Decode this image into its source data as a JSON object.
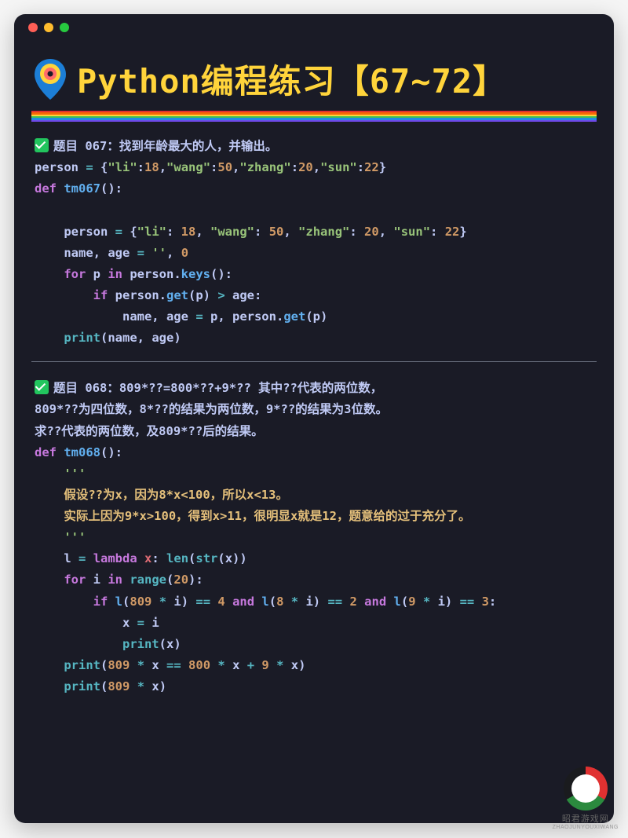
{
  "header": {
    "title": "Python编程练习【67~72】"
  },
  "block067": {
    "topic_prefix": "题目 067：",
    "topic_text": "找到年龄最大的人，并输出。",
    "line_data": "person = {\"li\":18,\"wang\":50,\"zhang\":20,\"sun\":22}",
    "def": "def tm067():",
    "l1": "    person = {\"li\": 18, \"wang\": 50, \"zhang\": 20, \"sun\": 22}",
    "l2": "    name, age = '', 0",
    "l3": "    for p in person.keys():",
    "l4": "        if person.get(p) > age:",
    "l5": "            name, age = p, person.get(p)",
    "l6": "    print(name, age)"
  },
  "block068": {
    "topic_prefix": "题目 068：",
    "topic_line1": "809*??=800*??+9*?? 其中??代表的两位数，",
    "topic_line2": "809*??为四位数，8*??的结果为两位数，9*??的结果为3位数。",
    "topic_line3": "求??代表的两位数，及809*??后的结果。",
    "def": "def tm068():",
    "doc_open": "    '''",
    "doc1": "    假设??为x，因为8*x<100，所以x<13。",
    "doc2": "    实际上因为9*x>100，得到x>11，很明显x就是12，题意给的过于充分了。",
    "doc_close": "    '''",
    "l1": "    l = lambda x: len(str(x))",
    "l2": "    for i in range(20):",
    "l3": "        if l(809 * i) == 4 and l(8 * i) == 2 and l(9 * i) == 3:",
    "l4": "            x = i",
    "l5": "            print(x)",
    "l6": "    print(809 * x == 800 * x + 9 * x)",
    "l7": "    print(809 * x)"
  },
  "watermark": {
    "name": "昭君游戏网",
    "url": "ZHAOJUNYOUXIWANG"
  }
}
